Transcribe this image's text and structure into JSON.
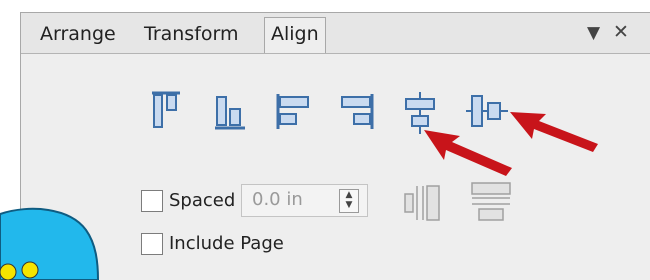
{
  "tabs": [
    {
      "label": "Arrange",
      "active": false
    },
    {
      "label": "Transform",
      "active": false
    },
    {
      "label": "Align",
      "active": true
    }
  ],
  "window_controls": {
    "menu_glyph": "▼",
    "close_glyph": "✕"
  },
  "align_buttons": [
    {
      "name": "align-top-icon"
    },
    {
      "name": "align-bottom-icon"
    },
    {
      "name": "align-left-icon"
    },
    {
      "name": "align-right-icon"
    },
    {
      "name": "align-center-horizontal-icon"
    },
    {
      "name": "align-center-vertical-icon"
    }
  ],
  "spacing": {
    "spaced_label": "Spaced",
    "spaced_checked": false,
    "value": "0.0 in",
    "distribute_icons": [
      "distribute-horizontal-icon",
      "distribute-vertical-icon"
    ]
  },
  "include_page": {
    "label": "Include Page",
    "checked": false
  },
  "colors": {
    "panel_bg": "#eeeeee",
    "icon_blue": "#3d6fa8",
    "icon_fill": "#c9daf0",
    "arrow_red": "#c8141a",
    "blob_blue": "#22b8ec",
    "blob_dot": "#f5e400"
  }
}
